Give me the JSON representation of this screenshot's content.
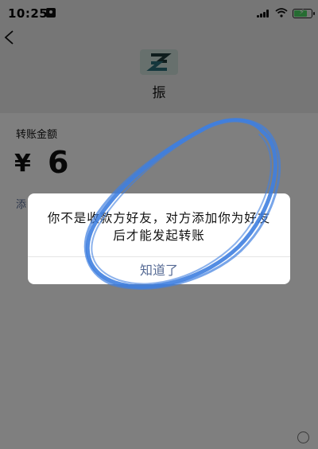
{
  "status_bar": {
    "time": "10:25"
  },
  "header": {
    "payee_name": "振",
    "avatar_letter": "Z"
  },
  "transfer": {
    "amount_label": "转账金额",
    "currency_symbol": "¥",
    "amount": "6",
    "remark_link": "添"
  },
  "dialog": {
    "message": "你不是收款方好友，对方添加你为好友后才能发起转账",
    "button_label": "知道了"
  },
  "colors": {
    "link": "#576b95",
    "annotation": "#3f7fe0",
    "avatar_bg": "#cfe0da"
  },
  "icons": {
    "back": "chevron-left-icon",
    "signal": "signal-icon",
    "wifi": "wifi-icon",
    "battery": "battery-charging-icon",
    "id": "id-card-icon"
  }
}
